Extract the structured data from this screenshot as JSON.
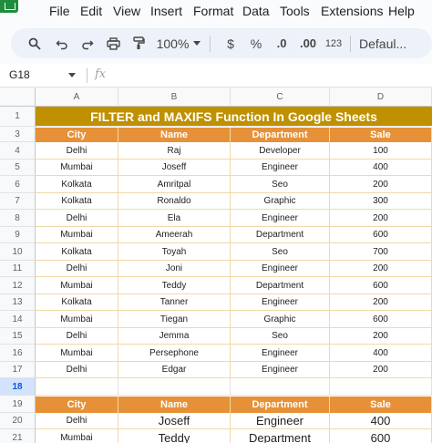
{
  "menu": {
    "items": [
      "File",
      "Edit",
      "View",
      "Insert",
      "Format",
      "Data",
      "Tools",
      "Extensions",
      "Help"
    ]
  },
  "toolbar": {
    "zoom": "100%",
    "currency": "$",
    "percent": "%",
    "decrease_decimal": ".0",
    "increase_decimal": ".00",
    "number_format": "123",
    "font": "Defaul..."
  },
  "formula_bar": {
    "name_box": "G18",
    "fx_label": "fx",
    "formula": ""
  },
  "sheet": {
    "columns": [
      "A",
      "B",
      "C",
      "D"
    ],
    "row_numbers": [
      "1",
      "3",
      "4",
      "5",
      "6",
      "7",
      "8",
      "9",
      "10",
      "11",
      "12",
      "13",
      "14",
      "15",
      "16",
      "17",
      "18",
      "19",
      "20",
      "21"
    ],
    "active_row": "18",
    "title": "FILTER and MAXIFS Function In Google Sheets",
    "headers": [
      "City",
      "Name",
      "Department",
      "Sale"
    ],
    "rows": [
      [
        "Delhi",
        "Raj",
        "Developer",
        "100"
      ],
      [
        "Mumbai",
        "Joseff",
        "Engineer",
        "400"
      ],
      [
        "Kolkata",
        "Amritpal",
        "Seo",
        "200"
      ],
      [
        "Kolkata",
        "Ronaldo",
        "Graphic",
        "300"
      ],
      [
        "Delhi",
        "Ela",
        "Engineer",
        "200"
      ],
      [
        "Mumbai",
        "Ameerah",
        "Department",
        "600"
      ],
      [
        "Kolkata",
        "Toyah",
        "Seo",
        "700"
      ],
      [
        "Delhi",
        "Joni",
        "Engineer",
        "200"
      ],
      [
        "Mumbai",
        "Teddy",
        "Department",
        "600"
      ],
      [
        "Kolkata",
        "Tanner",
        "Engineer",
        "200"
      ],
      [
        "Mumbai",
        "Tiegan",
        "Graphic",
        "600"
      ],
      [
        "Delhi",
        "Jemma",
        "Seo",
        "200"
      ],
      [
        "Mumbai",
        "Persephone",
        "Engineer",
        "400"
      ],
      [
        "Delhi",
        "Edgar",
        "Engineer",
        "200"
      ]
    ],
    "result_headers": [
      "City",
      "Name",
      "Department",
      "Sale"
    ],
    "result_rows": [
      [
        "Delhi",
        "Joseff",
        "Engineer",
        "400"
      ],
      [
        "Mumbai",
        "Teddy",
        "Department",
        "600"
      ]
    ]
  },
  "colors": {
    "title_bg": "#bf9000",
    "header_bg": "#e69138",
    "cell_border": "#f0d9a8",
    "sheets_green": "#1e8e3e"
  }
}
